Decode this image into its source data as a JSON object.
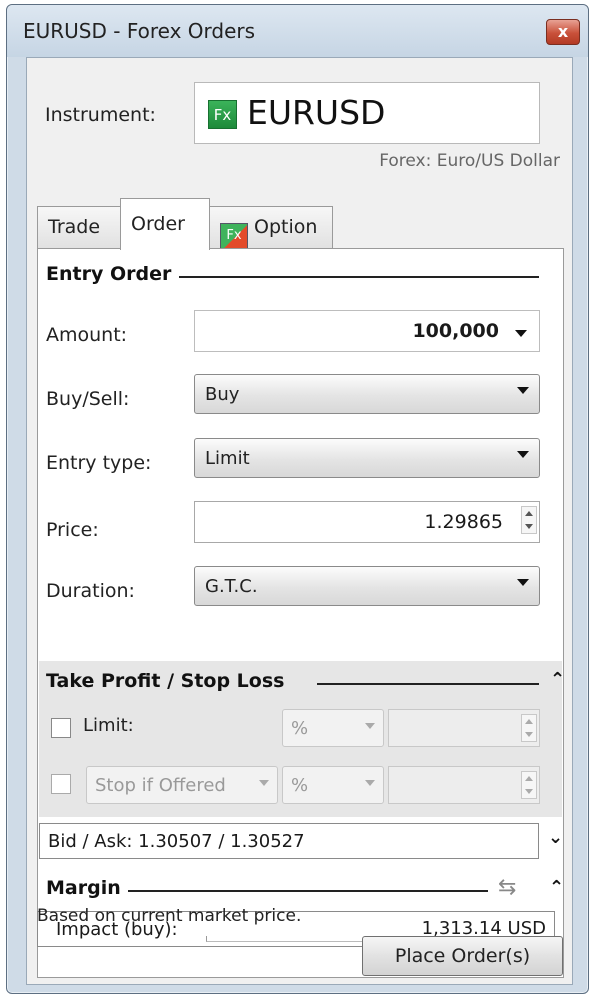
{
  "window": {
    "title": "EURUSD - Forex Orders",
    "close_glyph": "x"
  },
  "instrument": {
    "label": "Instrument:",
    "badge": "Fx",
    "symbol": "EURUSD",
    "description": "Forex: Euro/US Dollar"
  },
  "tabs": [
    {
      "label": "Trade",
      "selected": false
    },
    {
      "label": "Order",
      "selected": true
    },
    {
      "label": "Option",
      "selected": false,
      "icon": "fx-option-icon"
    }
  ],
  "entry_order": {
    "heading": "Entry Order",
    "amount": {
      "label": "Amount:",
      "value": "100,000"
    },
    "buy_sell": {
      "label": "Buy/Sell:",
      "value": "Buy"
    },
    "entry_type": {
      "label": "Entry type:",
      "value": "Limit"
    },
    "price": {
      "label": "Price:",
      "value": "1.29865"
    },
    "duration": {
      "label": "Duration:",
      "value": "G.T.C."
    }
  },
  "tp_sl": {
    "heading": "Take Profit / Stop Loss",
    "limit": {
      "label": "Limit:",
      "unit": "%"
    },
    "stop": {
      "type": "Stop if Offered",
      "unit": "%"
    }
  },
  "bid_ask": {
    "text": "Bid / Ask: 1.30507 / 1.30527"
  },
  "margin": {
    "heading": "Margin",
    "impact_label": "Impact (buy):",
    "impact_value": "1,313.14 USD"
  },
  "footer": {
    "note": "Based on current market price.",
    "place_button": "Place Order(s)"
  },
  "colors": {
    "title_bg": "#cfdbe7",
    "close_red": "#c9513a",
    "fx_green": "#2aa24a"
  }
}
